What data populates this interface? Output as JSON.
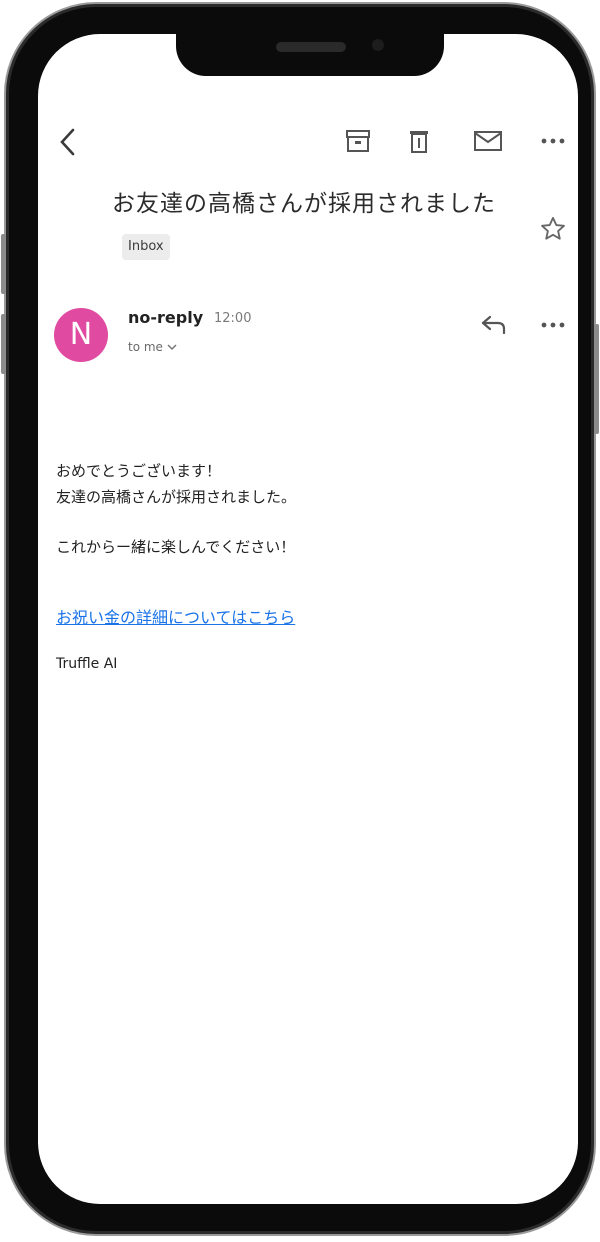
{
  "email": {
    "subject": "お友達の高橋さんが採用されました",
    "label": "Inbox",
    "sender": {
      "initial": "N",
      "name": "no-reply",
      "time": "12:00",
      "to": "to me"
    },
    "body": {
      "line1": "おめでとうございます！",
      "line2": "友達の高橋さんが採用されました。",
      "line3": "これからー緒に楽しんでください！",
      "link": "お祝い金の詳細についてはこちら",
      "signature": "Truffle AI"
    }
  },
  "icons": {
    "back": "back-chevron-icon",
    "archive": "archive-icon",
    "trash": "trash-icon",
    "mail": "mail-icon",
    "more": "more-horizontal-icon",
    "star": "star-icon",
    "reply": "reply-icon"
  },
  "colors": {
    "avatar": "#e04aa0",
    "link": "#1a73e8"
  }
}
